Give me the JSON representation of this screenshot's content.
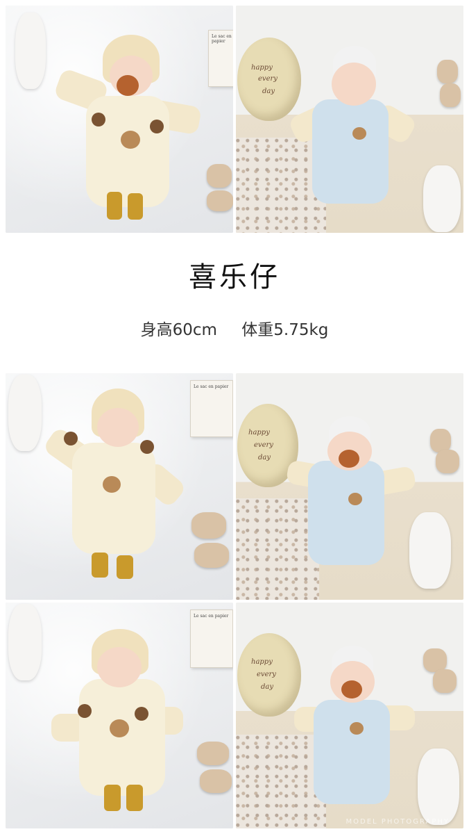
{
  "title": "喜乐仔",
  "stats": {
    "height": "身高60cm",
    "weight": "体重5.75kg"
  },
  "balloon_text": [
    "happy",
    "every",
    "day"
  ],
  "book_text": "Le sac en papier",
  "watermark": "MODEL PHOTOGRAPHY",
  "colors": {
    "background": "#ffffff",
    "title": "#111111",
    "stats": "#333333"
  }
}
